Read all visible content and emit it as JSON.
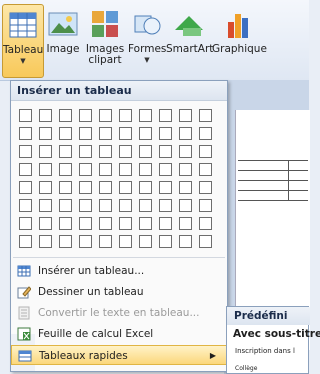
{
  "ribbon": {
    "buttons": [
      {
        "label": "Tableau",
        "dropdown": true
      },
      {
        "label": "Image"
      },
      {
        "label": "Images clipart"
      },
      {
        "label": "Formes",
        "dropdown": true
      },
      {
        "label": "SmartArt"
      },
      {
        "label": "Graphique"
      }
    ]
  },
  "menu": {
    "header": "Insérer un tableau",
    "grid": {
      "columns": 10,
      "rows": 8
    },
    "items": [
      {
        "label": "Insérer un tableau...",
        "icon": "table-icon",
        "enabled": true
      },
      {
        "label": "Dessiner un tableau",
        "icon": "pencil-icon",
        "enabled": true
      },
      {
        "label": "Convertir le texte en tableau...",
        "icon": "convert-icon",
        "enabled": false
      },
      {
        "label": "Feuille de calcul Excel",
        "icon": "excel-icon",
        "enabled": true
      },
      {
        "label": "Tableaux rapides",
        "icon": "quick-tables-icon",
        "enabled": true,
        "submenu": true
      }
    ]
  },
  "submenu": {
    "header": "Prédéfini",
    "title": "Avec sous-titre",
    "line1": "Inscription dans l",
    "line2": "Collège"
  }
}
